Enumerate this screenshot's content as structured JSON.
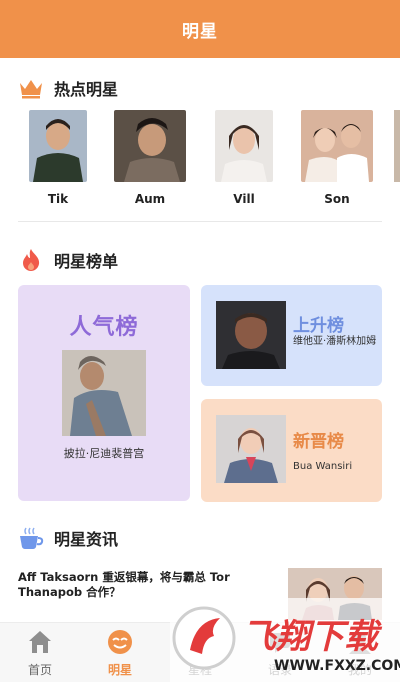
{
  "header": {
    "title": "明星"
  },
  "hot_section": {
    "label": "热点明星",
    "icon": "crown-icon"
  },
  "hot_stars": [
    {
      "name": "Tik"
    },
    {
      "name": "Aum"
    },
    {
      "name": "Vill"
    },
    {
      "name": "Son"
    }
  ],
  "ranking_section": {
    "label": "明星榜单",
    "icon": "flame-icon"
  },
  "rankings": {
    "popular": {
      "title": "人气榜",
      "star": "披拉·尼迪裴普宫"
    },
    "rising": {
      "title": "上升榜",
      "star": "维他亚·潘斯林加姆"
    },
    "new": {
      "title": "新晋榜",
      "star": "Bua Wansiri"
    }
  },
  "news_section": {
    "label": "明星资讯",
    "icon": "coffee-cup-icon"
  },
  "news": [
    {
      "headline": "Aff Taksaorn 重返银幕，将与霸总 Tor Thanapob 合作？"
    }
  ],
  "tabbar": [
    {
      "label": "首页",
      "icon": "home-icon",
      "active": false
    },
    {
      "label": "明星",
      "icon": "star-face-icon",
      "active": true
    },
    {
      "label": "星程",
      "icon": "calendar-icon",
      "active": false
    },
    {
      "label": "语录",
      "icon": "quote-icon",
      "active": false
    },
    {
      "label": "我的",
      "icon": "user-icon",
      "active": false
    }
  ],
  "watermark": {
    "brand": "飞翔下载",
    "url": "WWW.FXXZ.COM"
  },
  "colors": {
    "accent": "#f0914a",
    "popular_card": "#e8dcf6",
    "rising_card": "#d6e2fb",
    "new_card": "#fbdcc6"
  }
}
